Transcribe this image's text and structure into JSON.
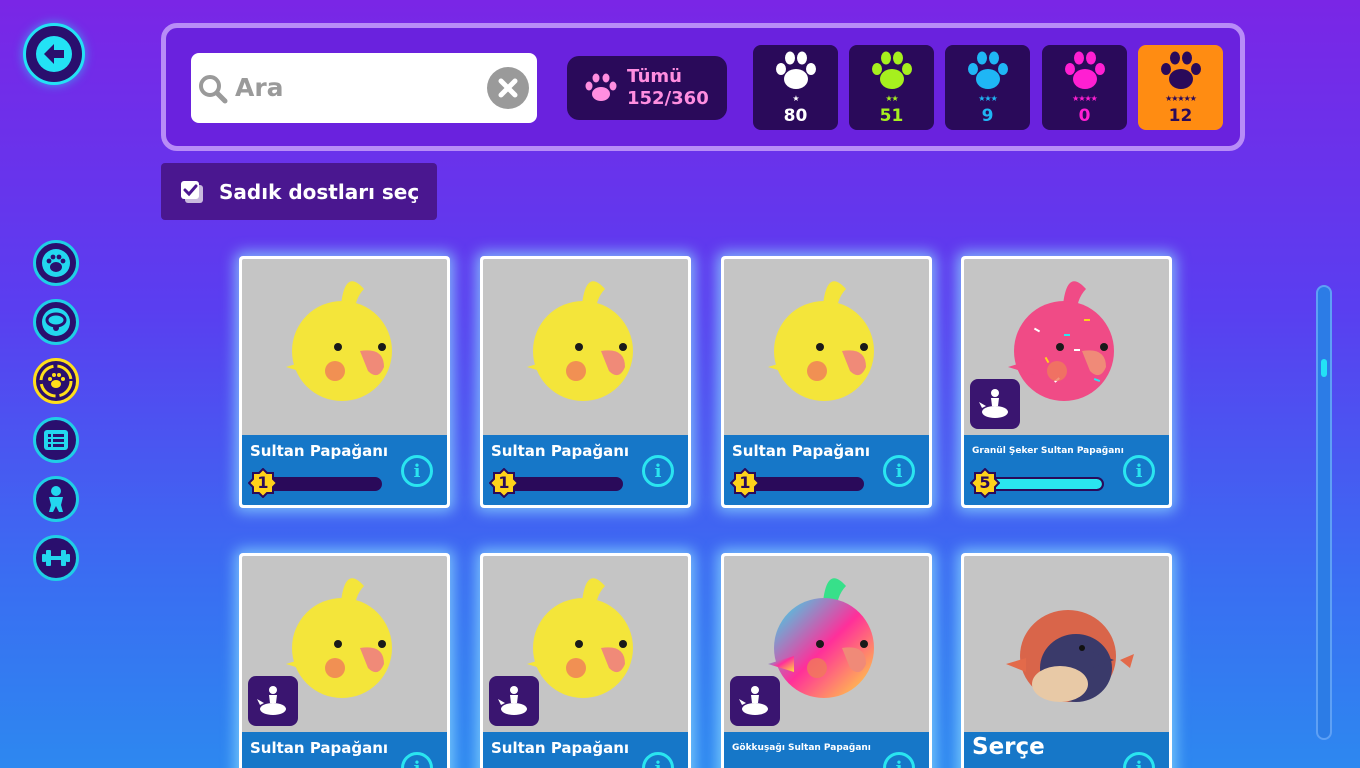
{
  "search": {
    "placeholder": "Ara"
  },
  "all_filter": {
    "label": "Tümü",
    "count": "152/360"
  },
  "rarities": [
    {
      "stars": "★",
      "count": "80",
      "color": "#ffffff"
    },
    {
      "stars": "★★",
      "count": "51",
      "color": "#a6f01e"
    },
    {
      "stars": "★★★",
      "count": "9",
      "color": "#1fb6f5"
    },
    {
      "stars": "★★★★",
      "count": "0",
      "color": "#ff1fd2"
    },
    {
      "stars": "★★★★★",
      "count": "12",
      "color": "#2a0a5a"
    }
  ],
  "select_button": {
    "label": "Sadık dostları seç"
  },
  "side_nav": [
    {
      "icon": "paw-icon"
    },
    {
      "icon": "collar-icon"
    },
    {
      "icon": "paw-cycle-icon"
    },
    {
      "icon": "list-icon"
    },
    {
      "icon": "person-icon"
    },
    {
      "icon": "dumbbell-icon"
    }
  ],
  "cards": [
    {
      "name": "Sultan Papağanı",
      "level": "1",
      "progress": 0.0,
      "mount": false
    },
    {
      "name": "Sultan Papağanı",
      "level": "1",
      "progress": 0.0,
      "mount": false
    },
    {
      "name": "Sultan Papağanı",
      "level": "1",
      "progress": 0.0,
      "mount": false
    },
    {
      "name": "Granül Şeker Sultan Papağanı",
      "level": "5",
      "progress": 1.0,
      "mount": true
    },
    {
      "name": "Sultan Papağanı",
      "level": "",
      "progress": 0.0,
      "mount": true
    },
    {
      "name": "Sultan Papağanı",
      "level": "",
      "progress": 0.0,
      "mount": true
    },
    {
      "name": "Gökkuşağı Sultan Papağanı",
      "level": "",
      "progress": 0.0,
      "mount": true
    },
    {
      "name": "Serçe",
      "level": "",
      "progress": 0.0,
      "mount": false
    }
  ]
}
